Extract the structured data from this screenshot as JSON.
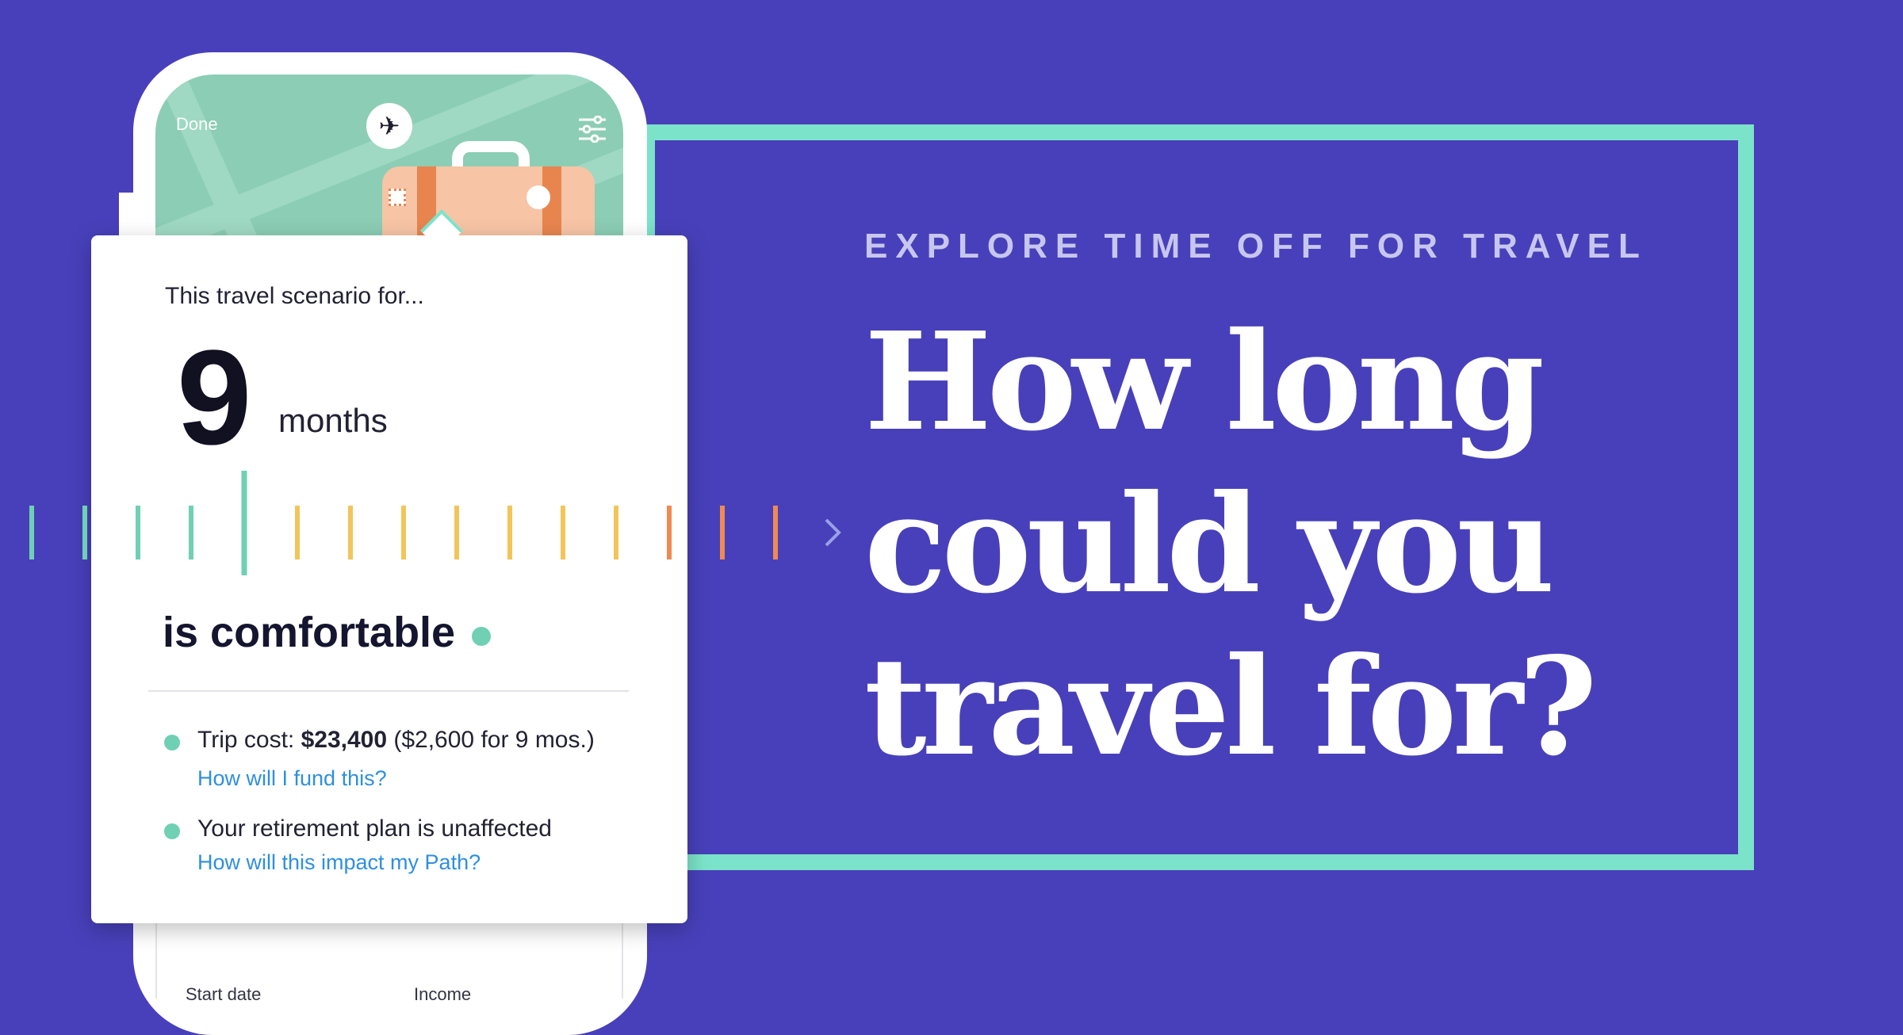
{
  "hero": {
    "eyebrow": "EXPLORE TIME OFF FOR TRAVEL",
    "headline_lines": [
      "How long",
      "could you",
      "travel for?"
    ]
  },
  "phone": {
    "done_label": "Done",
    "plane_icon": "airplane-icon",
    "filter_icon": "sliders-icon",
    "bottom_labels": [
      "Start date",
      "Income"
    ]
  },
  "card": {
    "subtitle": "This travel scenario for...",
    "duration_value": "9",
    "duration_unit": "months",
    "status": "is comfortable",
    "trip_cost_label": "Trip cost: ",
    "trip_cost_value": "$23,400",
    "trip_cost_detail": " ($2,600 for 9 mos.)",
    "fund_link": "How will I fund this?",
    "retirement_text": "Your retirement plan is unaffected",
    "impact_link": "How will this impact my Path?"
  },
  "scale": {
    "selected_index": 4,
    "colors": [
      "#6fd0b4",
      "#6fd0b4",
      "#6fd0b4",
      "#6fd0b4",
      "#6fd0b4",
      "#f2c55a",
      "#f2c55a",
      "#f2c55a",
      "#f2c55a",
      "#f2c55a",
      "#f2c55a",
      "#f2c55a",
      "#ef8a52",
      "#ef8a52",
      "#ef8a52"
    ],
    "next_icon": "chevron-right-icon"
  },
  "colors": {
    "background": "#4840ba",
    "frame": "#7be3c9",
    "comfortable": "#6fd0b4",
    "caution": "#f2c55a",
    "risk": "#ef8a52",
    "link": "#2e8fe0"
  }
}
